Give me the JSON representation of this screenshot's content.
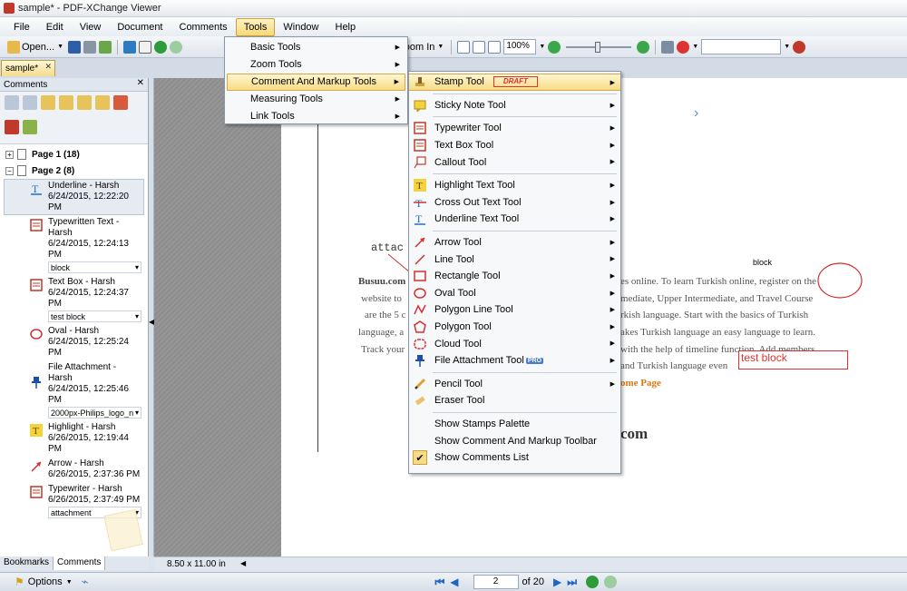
{
  "window": {
    "title": "sample* - PDF-XChange Viewer"
  },
  "menubar": [
    "File",
    "Edit",
    "View",
    "Document",
    "Comments",
    "Tools",
    "Window",
    "Help"
  ],
  "toolbar": {
    "open_label": "Open...",
    "zoom_in_label": "Zoom In",
    "zoom_value": "100%"
  },
  "doc_tab": {
    "label": "sample*"
  },
  "comments_panel": {
    "title": "Comments",
    "pages": [
      {
        "label": "Page 1 (18)"
      },
      {
        "label": "Page 2 (8)"
      }
    ],
    "items": [
      {
        "title": "Underline - Harsh",
        "date": "6/24/2015, 12:22:20 PM",
        "note": "",
        "icon": "underline-icon",
        "color": "#1e6fd0"
      },
      {
        "title": "Typewritten Text - Harsh",
        "date": "6/24/2015, 12:24:13 PM",
        "note": "block",
        "icon": "typewriter-icon",
        "color": "#c0392b"
      },
      {
        "title": "Text Box - Harsh",
        "date": "6/24/2015, 12:24:37 PM",
        "note": "test block",
        "icon": "textbox-icon",
        "color": "#c0392b"
      },
      {
        "title": "Oval - Harsh",
        "date": "6/24/2015, 12:25:24 PM",
        "note": "",
        "icon": "oval-icon",
        "color": "#d32f2f"
      },
      {
        "title": "File Attachment - Harsh",
        "date": "6/24/2015, 12:25:46 PM",
        "note": "2000px-Philips_logo_n",
        "icon": "pushpin-icon",
        "color": "#1e4fa8"
      },
      {
        "title": "Highlight - Harsh",
        "date": "6/26/2015, 12:19:44 PM",
        "note": "",
        "icon": "highlight-icon",
        "color": "#e0b400"
      },
      {
        "title": "Arrow - Harsh",
        "date": "6/26/2015, 2:37:36 PM",
        "note": "",
        "icon": "arrow-icon",
        "color": "#d32f2f"
      },
      {
        "title": "Typewriter - Harsh",
        "date": "6/26/2015, 2:37:49 PM",
        "note": "attachment",
        "icon": "typewriter-icon",
        "color": "#c0392b"
      }
    ]
  },
  "bottom_tabs": [
    "Bookmarks",
    "Comments"
  ],
  "tools_menu": [
    "Basic Tools",
    "Zoom Tools",
    "Comment And Markup Tools",
    "Measuring Tools",
    "Link Tools"
  ],
  "markup_menu": {
    "stamp": "Stamp Tool",
    "draft": "DRAFT",
    "sticky": "Sticky Note Tool",
    "typewriter": "Typewriter Tool",
    "textbox": "Text Box Tool",
    "callout": "Callout Tool",
    "highlight": "Highlight Text Tool",
    "crossout": "Cross Out Text Tool",
    "underline": "Underline Text Tool",
    "arrow": "Arrow Tool",
    "line": "Line Tool",
    "rectangle": "Rectangle Tool",
    "oval": "Oval Tool",
    "polygonline": "Polygon Line Tool",
    "polygon": "Polygon Tool",
    "cloud": "Cloud Tool",
    "fileattach": "File Attachment Tool",
    "pro": "PRO",
    "pencil": "Pencil Tool",
    "eraser": "Eraser Tool",
    "show_stamps": "Show Stamps Palette",
    "show_toolbar": "Show Comment And Markup Toolbar",
    "show_list": "Show Comments List"
  },
  "document": {
    "attach_label": "attac",
    "block_label": "block",
    "testblock_label": "test block",
    "line1_left": "Busuu.com",
    "line1_right": "es online. To learn Turkish online, register on the",
    "line2_left": "website to",
    "line2_right": "mediate, Upper Intermediate, and Travel Course",
    "line3_left": "are the 5 c",
    "line3_right": "rkish language. Start with the basics of Turkish",
    "line4_left": "language, a",
    "line4_right": "akes Turkish language an easy language to learn.",
    "line5_left": "Track your",
    "line5_right": "with the help of timeline function. Add members",
    "line6_right": "and Turkish language even",
    "home_page": "ome Page",
    "com": "com"
  },
  "status": {
    "page_size": "8.50 x 11.00 in"
  },
  "navbar": {
    "options": "Options",
    "current_page": "2",
    "page_count": "of 20"
  }
}
